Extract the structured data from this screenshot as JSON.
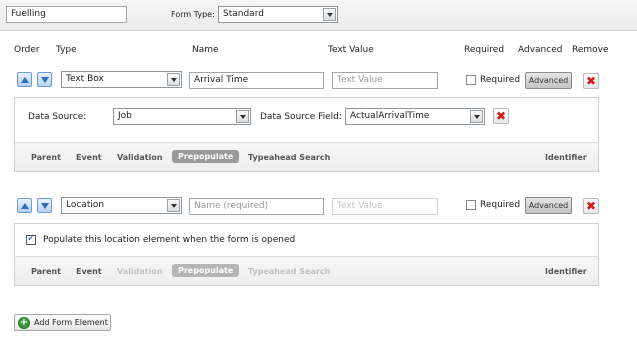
{
  "header": {
    "form_name": "Fuelling",
    "form_type_label": "Form Type:",
    "form_type_value": "Standard"
  },
  "columns": {
    "order": "Order",
    "type": "Type",
    "name": "Name",
    "text_value": "Text Value",
    "required": "Required",
    "advanced": "Advanced",
    "remove": "Remove"
  },
  "element1": {
    "type": "Text Box",
    "name": "Arrival Time",
    "text_value_placeholder": "Text Value",
    "required_label": "Required",
    "required_checked": false,
    "advanced_label": "Advanced",
    "data_source_label": "Data Source:",
    "data_source_value": "Job",
    "data_source_field_label": "Data Source Field:",
    "data_source_field_value": "ActualArrivalTime",
    "tabs": [
      "Parent",
      "Event",
      "Validation",
      "Prepopulate",
      "Typeahead Search",
      "Identifier"
    ],
    "active_tab": "Prepopulate"
  },
  "element2": {
    "type": "Location",
    "name_placeholder": "Name (required)",
    "text_value_placeholder": "Text Value",
    "required_label": "Required",
    "required_checked": false,
    "advanced_label": "Advanced",
    "populate_label": "Populate this location element when the form is opened",
    "populate_checked": true,
    "tabs": [
      "Parent",
      "Event",
      "Validation",
      "Prepopulate",
      "Typeahead Search",
      "Identifier"
    ],
    "active_tab": "Prepopulate"
  },
  "footer": {
    "add_label": "Add Form Element"
  },
  "colors": {
    "remove_icon": "#d41919",
    "add_icon": "#3a9a3a",
    "arrow_icon": "#2a6ec0"
  }
}
